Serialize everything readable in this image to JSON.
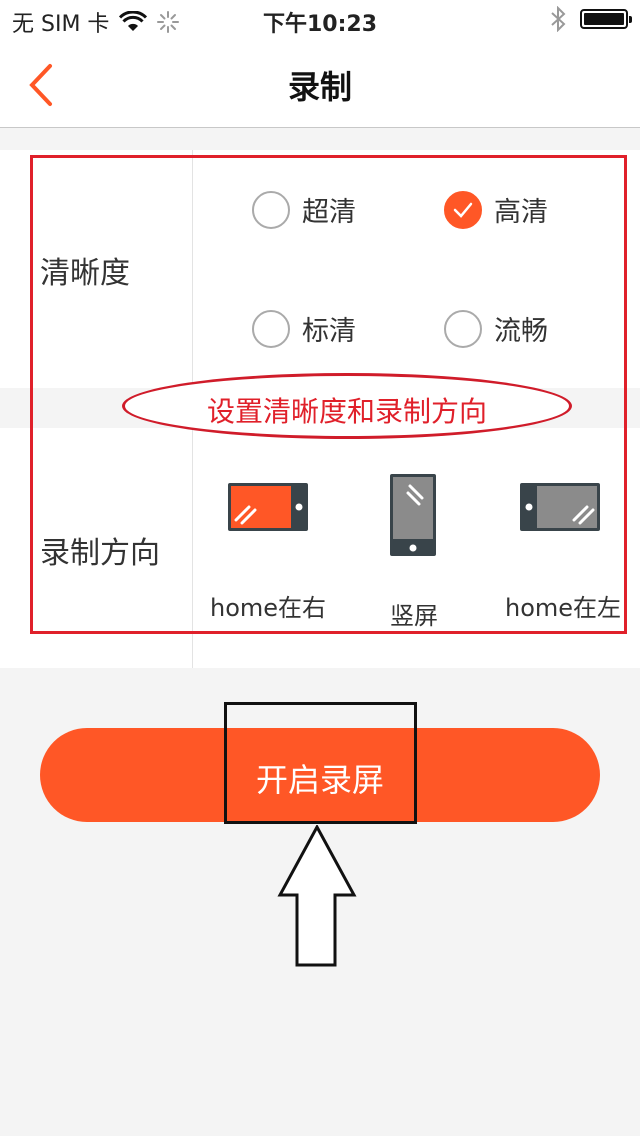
{
  "status_bar": {
    "carrier": "无 SIM 卡",
    "time": "下午10:23"
  },
  "nav": {
    "title": "录制",
    "accent_color": "#ff5726"
  },
  "clarity": {
    "label": "清晰度",
    "options": [
      {
        "label": "超清",
        "selected": false
      },
      {
        "label": "高清",
        "selected": true
      },
      {
        "label": "标清",
        "selected": false
      },
      {
        "label": "流畅",
        "selected": false
      }
    ]
  },
  "direction": {
    "label": "录制方向",
    "options": [
      {
        "label": "home在右",
        "icon": "phone-landscape-home-right-icon",
        "selected": true
      },
      {
        "label": "竖屏",
        "icon": "phone-portrait-icon",
        "selected": false
      },
      {
        "label": "home在左",
        "icon": "phone-landscape-home-left-icon",
        "selected": false
      }
    ]
  },
  "annotation": {
    "text": "设置清晰度和录制方向",
    "color": "#e0202a"
  },
  "start_button": {
    "label": "开启录屏"
  }
}
